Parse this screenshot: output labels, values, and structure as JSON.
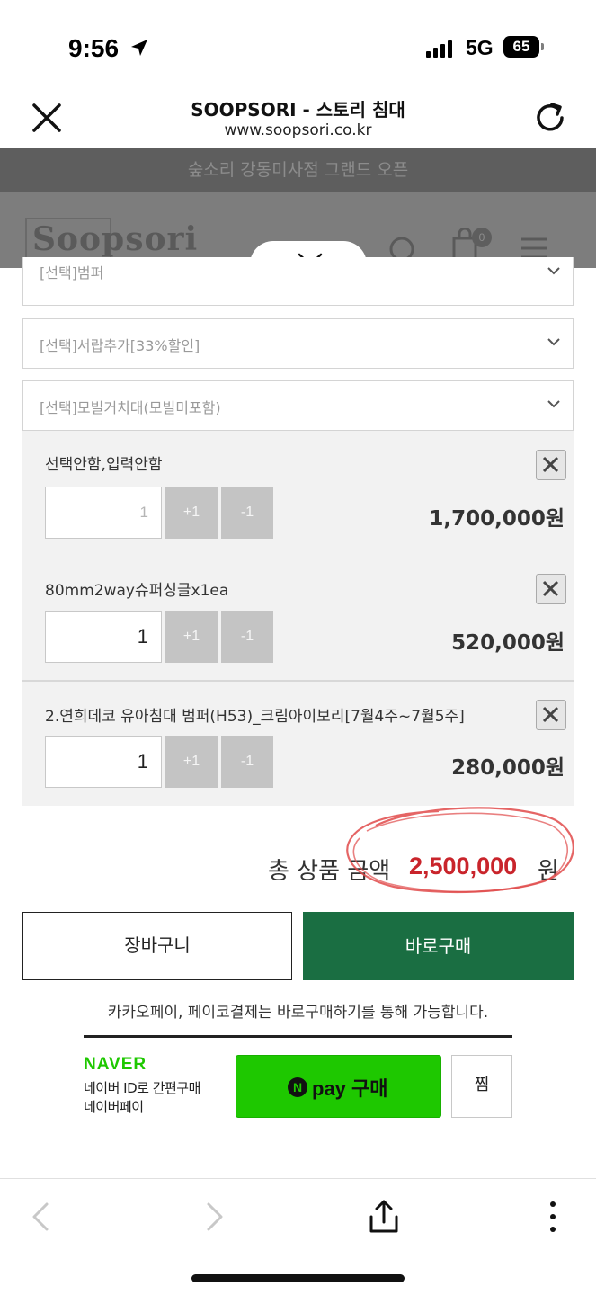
{
  "status_bar": {
    "time": "9:56",
    "network": "5G",
    "battery": "65"
  },
  "browser": {
    "title": "SOOPSORI - 스토리 침대",
    "url": "www.soopsori.co.kr"
  },
  "page_behind": {
    "banner": "숲소리 강동미사점 그랜드 오픈",
    "logo": "Soopsori",
    "cart_count": "0"
  },
  "selects": [
    {
      "label": "[선택]범퍼"
    },
    {
      "label": "[선택]서랍추가[33%할인]"
    },
    {
      "label": "[선택]모빌거치대(모빌미포함)"
    }
  ],
  "items": [
    {
      "name": "선택안함,입력안함",
      "qty": "1",
      "plus": "+1",
      "minus": "-1",
      "price": "1,700,000원"
    },
    {
      "name": "80mm2way슈퍼싱글x1ea",
      "qty": "1",
      "plus": "+1",
      "minus": "-1",
      "price": "520,000원"
    },
    {
      "name": "2.연희데코 유아침대 범퍼(H53)_크림아이보리[7월4주~7월5주]",
      "qty": "1",
      "plus": "+1",
      "minus": "-1",
      "price": "280,000원"
    }
  ],
  "total": {
    "label": "총 상품 금액",
    "value": "2,500,000",
    "unit": "원"
  },
  "actions": {
    "cart": "장바구니",
    "buy_now": "바로구매",
    "note": "카카오페이, 페이코결제는 바로구매하기를 통해 가능합니다."
  },
  "naver": {
    "logo": "NAVER",
    "line1": "네이버 ID로 간편구매",
    "line2": "네이버페이",
    "npay_symbol": "N",
    "npay_label": "pay 구매",
    "wish": "찜"
  },
  "colors": {
    "buy_green": "#1a6e42",
    "naver_green": "#1ec800",
    "total_red": "#c9242b"
  }
}
